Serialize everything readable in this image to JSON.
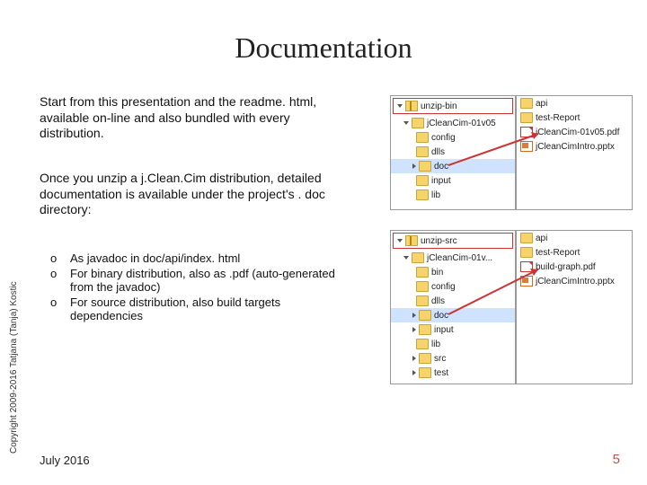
{
  "title": "Documentation",
  "paragraph1": "Start from this presentation and the readme. html, available on-line and also bundled with every distribution.",
  "paragraph2": "Once you unzip a j.Clean.Cim distribution, detailed documentation is available under the project's . doc directory:",
  "bullets": [
    "As javadoc in doc/api/index. html",
    "For binary distribution,  also as .pdf (auto-generated from the javadoc)",
    "For source distribution, also build targets dependencies"
  ],
  "copyright": "Copyright 2009-2016 Tatjana (Tanja) Kostic",
  "footer_date": "July 2016",
  "page_number": "5",
  "shot1": {
    "left_title": "unzip-bin",
    "left_items": [
      "jCleanCim-01v05",
      "config",
      "dlls",
      "doc",
      "input",
      "lib"
    ],
    "right_items": [
      "api",
      "test-Report",
      "jCleanCim-01v05.pdf",
      "jCleanCimIntro.pptx"
    ]
  },
  "shot2": {
    "left_title": "unzip-src",
    "left_items": [
      "jCleanCim-01v...",
      "bin",
      "config",
      "dlls",
      "doc",
      "input",
      "lib",
      "src",
      "test"
    ],
    "right_items": [
      "api",
      "test-Report",
      "build-graph.pdf",
      "jCleanCimIntro.pptx"
    ]
  }
}
